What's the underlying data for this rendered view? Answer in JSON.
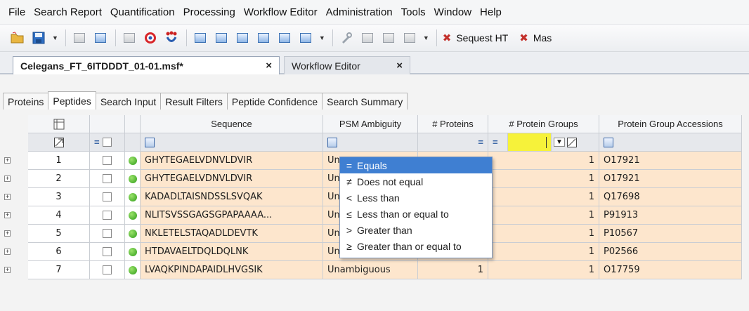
{
  "menu": [
    "File",
    "Search Report",
    "Quantification",
    "Processing",
    "Workflow Editor",
    "Administration",
    "Tools",
    "Window",
    "Help"
  ],
  "toolbar": {
    "sequest_label": "Sequest HT",
    "mascot_label": "Mas"
  },
  "doc_tabs": [
    {
      "label": "Celegans_FT_6ITDDDT_01-01.msf*",
      "close": "×"
    },
    {
      "label": "Workflow Editor",
      "close": "×"
    }
  ],
  "sub_tabs": [
    "Proteins",
    "Peptides",
    "Search Input",
    "Result Filters",
    "Peptide Confidence",
    "Search Summary"
  ],
  "grid": {
    "columns": [
      "Sequence",
      "PSM Ambiguity",
      "# Proteins",
      "# Protein Groups",
      "Protein Group Accessions"
    ],
    "filter_ops": {
      "checked": "=",
      "proteins": "=",
      "groups": "="
    },
    "rows": [
      {
        "num": "1",
        "sequence": "GHYTEGAELVDNVLDVIR",
        "ambiguity": "Unar",
        "proteins": "",
        "groups": "1",
        "accession": "O17921"
      },
      {
        "num": "2",
        "sequence": "GHYTEGAELVDNVLDVIR",
        "ambiguity": "Unar",
        "proteins": "",
        "groups": "1",
        "accession": "O17921"
      },
      {
        "num": "3",
        "sequence": "KADADLTAISNDSSLSVQAK",
        "ambiguity": "Unar",
        "proteins": "",
        "groups": "1",
        "accession": "Q17698"
      },
      {
        "num": "4",
        "sequence": "NLITSVSSGAGSGPAPAAAA...",
        "ambiguity": "Unar",
        "proteins": "",
        "groups": "1",
        "accession": "P91913"
      },
      {
        "num": "5",
        "sequence": "NKLETELSTAQADLDEVTK",
        "ambiguity": "Unar",
        "proteins": "",
        "groups": "1",
        "accession": "P10567"
      },
      {
        "num": "6",
        "sequence": "HTDAVAELTDQLDQLNK",
        "ambiguity": "Unambiguous",
        "proteins": "1",
        "groups": "1",
        "accession": "P02566"
      },
      {
        "num": "7",
        "sequence": "LVAQKPINDAPAIDLHVGSIK",
        "ambiguity": "Unambiguous",
        "proteins": "1",
        "groups": "1",
        "accession": "O17759"
      }
    ]
  },
  "dropdown": [
    {
      "symbol": "=",
      "label": "Equals",
      "selected": true
    },
    {
      "symbol": "≠",
      "label": "Does not equal"
    },
    {
      "symbol": "<",
      "label": "Less than"
    },
    {
      "symbol": "≤",
      "label": "Less than or equal to"
    },
    {
      "symbol": ">",
      "label": "Greater than"
    },
    {
      "symbol": "≥",
      "label": "Greater than or equal to"
    }
  ],
  "colors": {
    "row_highlight": "#fde6cd",
    "filter_active": "#f6f23a",
    "menu_selected": "#3f7fd2"
  }
}
